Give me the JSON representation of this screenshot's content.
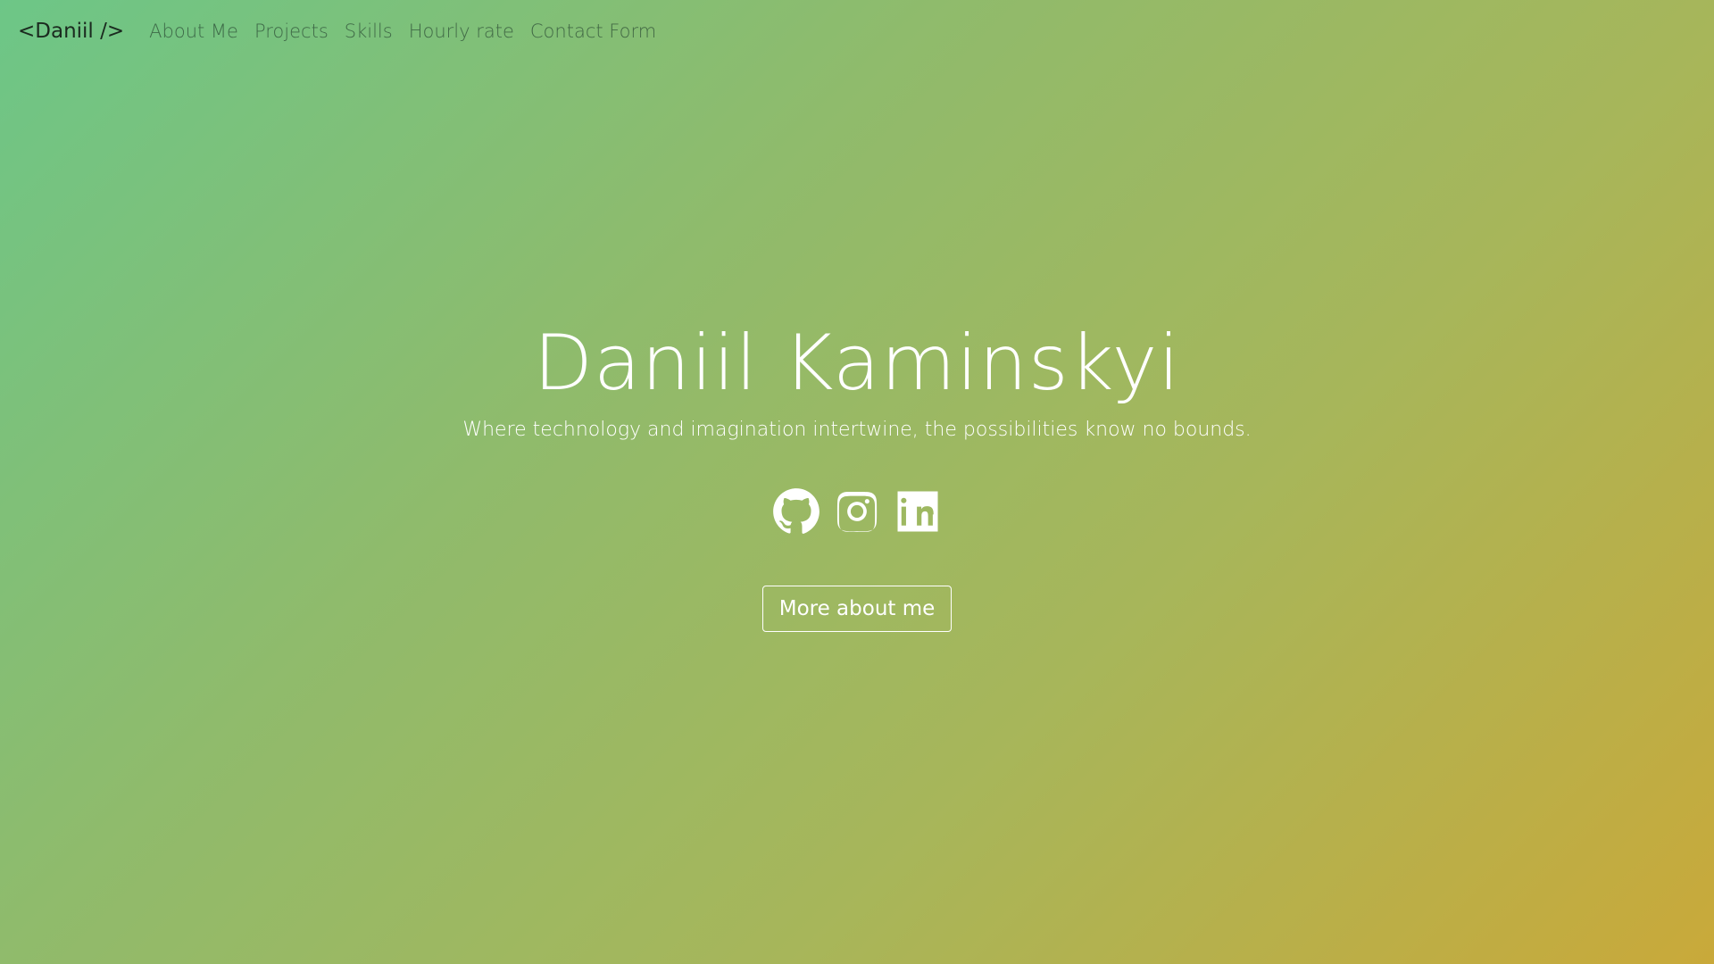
{
  "navbar": {
    "brand": "<Daniil />",
    "links": [
      {
        "label": "About Me"
      },
      {
        "label": "Projects"
      },
      {
        "label": "Skills"
      },
      {
        "label": "Hourly rate"
      },
      {
        "label": "Contact Form"
      }
    ]
  },
  "hero": {
    "title": "Daniil Kaminskyi",
    "tagline": "Where technology and imagination intertwine, the possibilities know no bounds.",
    "socials": [
      {
        "icon": "github-icon"
      },
      {
        "icon": "instagram-icon"
      },
      {
        "icon": "linkedin-icon"
      }
    ],
    "cta_label": "More about me"
  },
  "colors": {
    "gradient_start": "#6dc687",
    "gradient_end": "#c9a93a",
    "text": "#ffffff",
    "brand_text": "#1b2a1f"
  }
}
